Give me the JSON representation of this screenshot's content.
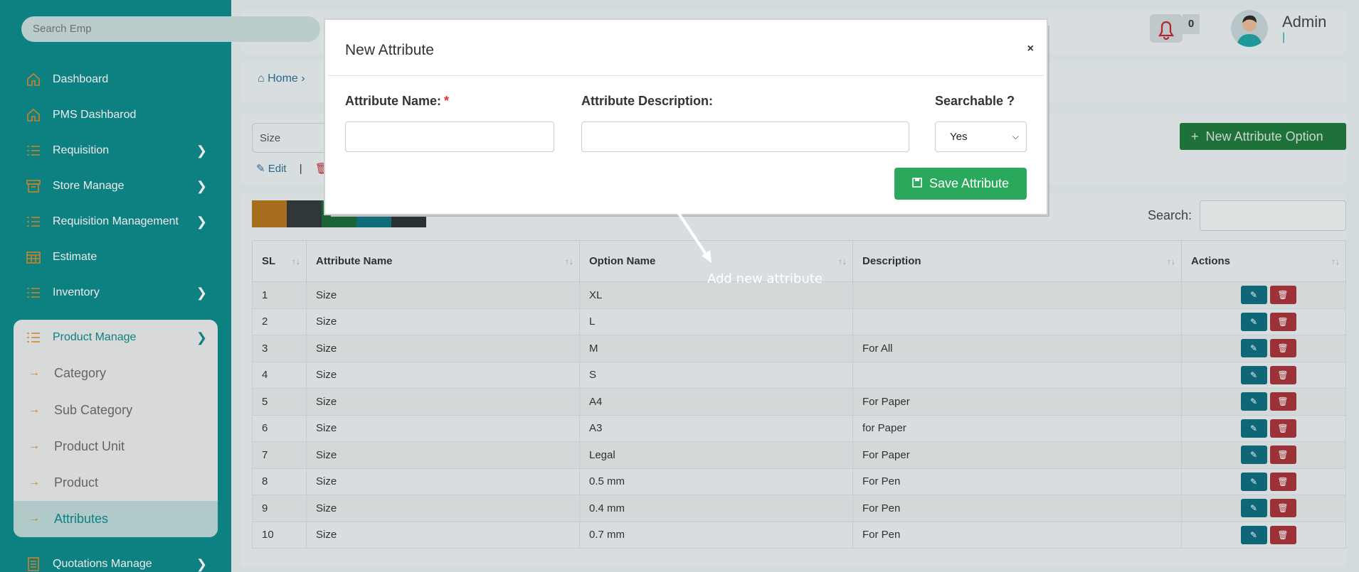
{
  "sidebar": {
    "menu_dots": "···",
    "items": [
      {
        "label": "Dashboard",
        "icon": "home-icon"
      },
      {
        "label": "PMS Dashbarod",
        "icon": "home-icon"
      },
      {
        "label": "Requisition",
        "icon": "list-icon"
      },
      {
        "label": "Store Manage",
        "icon": "store-icon"
      },
      {
        "label": "Requisition Management",
        "icon": "list-icon"
      },
      {
        "label": "Estimate",
        "icon": "calendar-icon"
      },
      {
        "label": "Inventory",
        "icon": "list-icon"
      },
      {
        "label": "Product Manage",
        "icon": "list-icon"
      },
      {
        "label": "Quotations Manage",
        "icon": "document-icon"
      }
    ],
    "sub_items": [
      "Category",
      "Sub Category",
      "Product Unit",
      "Product",
      "Attributes"
    ]
  },
  "header": {
    "search_placeholder": "Search Emp",
    "notification_count": "0",
    "user_name": "Admin",
    "user_sub": "|"
  },
  "breadcrumb": {
    "home": "Home"
  },
  "filter": {
    "selected": "Size",
    "edit_label": "Edit"
  },
  "buttons": {
    "new_attribute_option": "New Attribute Option"
  },
  "table": {
    "search_label": "Search:",
    "headers": [
      "SL",
      "Attribute Name",
      "Option Name",
      "Description",
      "Actions"
    ],
    "rows": [
      [
        "1",
        "Size",
        "XL",
        ""
      ],
      [
        "2",
        "Size",
        "L",
        ""
      ],
      [
        "3",
        "Size",
        "M",
        "For All"
      ],
      [
        "4",
        "Size",
        "S",
        ""
      ],
      [
        "5",
        "Size",
        "A4",
        "For Paper"
      ],
      [
        "6",
        "Size",
        "A3",
        "for Paper"
      ],
      [
        "7",
        "Size",
        "Legal",
        "For Paper"
      ],
      [
        "8",
        "Size",
        "0.5 mm",
        "For Pen"
      ],
      [
        "9",
        "Size",
        "0.4 mm",
        "For Pen"
      ],
      [
        "10",
        "Size",
        "0.7 mm",
        "For Pen"
      ]
    ]
  },
  "modal": {
    "title": "New Attribute",
    "close": "×",
    "name_label": "Attribute Name:",
    "required_mark": "*",
    "description_label": "Attribute Description:",
    "searchable_label": "Searchable ?",
    "searchable_value": "Yes",
    "save_label": "Save Attribute"
  },
  "annotation": "Add new attribute",
  "colors": {
    "sidebar": "#0d8a8a",
    "save": "#2aa85b",
    "new_option": "#1f7a3c",
    "edit_btn": "#0e6d7e",
    "delete_btn": "#a8333b",
    "accent_arrow": "#d98b2b"
  }
}
